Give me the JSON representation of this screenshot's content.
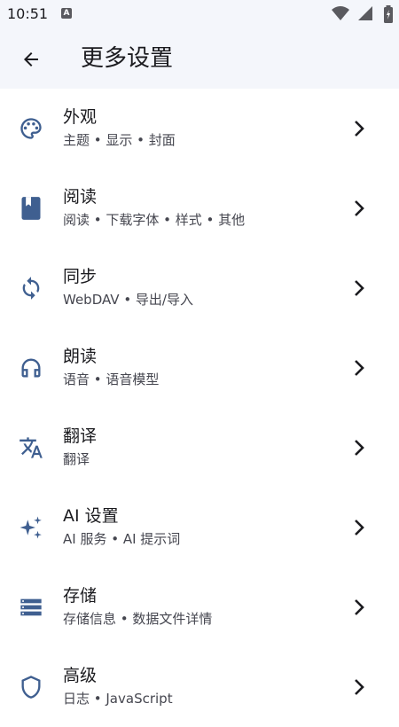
{
  "status_bar": {
    "time": "10:51",
    "notification_badge": "A"
  },
  "app_bar": {
    "title": "更多设置",
    "back_icon": "arrow-left-icon"
  },
  "colors": {
    "accent": "#3f5f90",
    "background": "#ffffff",
    "bar_background": "#f4f6fb"
  },
  "items": [
    {
      "label": "外观",
      "desc": "主题 • 显示 • 封面",
      "icon": "palette-icon"
    },
    {
      "label": "阅读",
      "desc": "阅读 • 下载字体 • 样式 • 其他",
      "icon": "book-icon"
    },
    {
      "label": "同步",
      "desc": "WebDAV • 导出/导入",
      "icon": "sync-icon"
    },
    {
      "label": "朗读",
      "desc": "语音 • 语音模型",
      "icon": "headphones-icon"
    },
    {
      "label": "翻译",
      "desc": "翻译",
      "icon": "translate-icon"
    },
    {
      "label": "AI 设置",
      "desc": "AI 服务 • AI 提示词",
      "icon": "sparkle-icon"
    },
    {
      "label": "存储",
      "desc": "存储信息 • 数据文件详情",
      "icon": "storage-icon"
    },
    {
      "label": "高级",
      "desc": "日志 • JavaScript",
      "icon": "shield-icon"
    }
  ]
}
